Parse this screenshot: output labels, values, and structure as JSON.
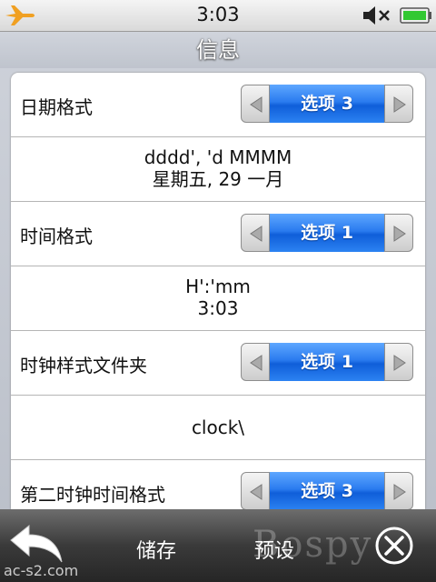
{
  "status": {
    "time": "3:03",
    "airplane_icon": "airplane-icon",
    "mute_icon": "speaker-muted-icon",
    "battery_icon": "battery-icon",
    "battery_color": "#32c832"
  },
  "title": "信息",
  "settings": [
    {
      "label": "日期格式",
      "value": "选项 3",
      "info_lines": [
        "dddd', 'd MMMM",
        "星期五, 29 一月"
      ]
    },
    {
      "label": "时间格式",
      "value": "选项 1",
      "info_lines": [
        "H':'mm",
        "3:03"
      ]
    },
    {
      "label": "时钟样式文件夹",
      "value": "选项 1",
      "info_lines": [
        "clock\\"
      ]
    },
    {
      "label": "第二时钟时间格式",
      "value": "选项 3"
    }
  ],
  "bottom": {
    "back_icon": "back-arrow-icon",
    "save_label": "储存",
    "preset_label": "预设",
    "close_icon": "close-icon",
    "watermark": "Bospy",
    "site": "ac-s2.com"
  },
  "colors": {
    "accent_blue": "#1f6fe8",
    "titlebar": "#c9ced7",
    "bottombar": "#3a3a3a"
  }
}
